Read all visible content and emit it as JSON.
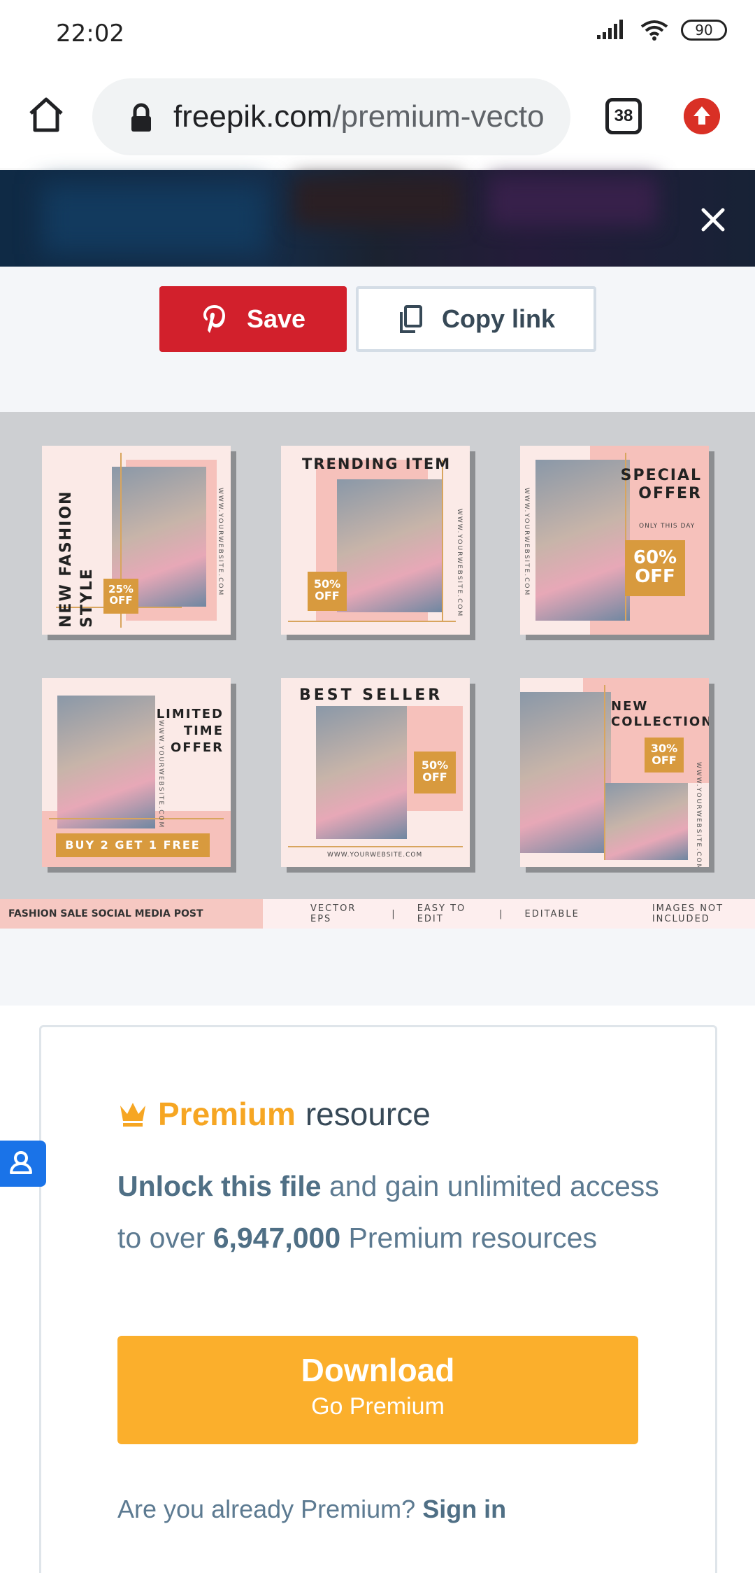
{
  "status_bar": {
    "time": "22:02",
    "battery": "90"
  },
  "browser": {
    "url_domain": "freepik.com",
    "url_path": "/premium-vecto",
    "tab_count": "38"
  },
  "share": {
    "save_label": "Save",
    "copy_label": "Copy link"
  },
  "preview": {
    "tiles": [
      {
        "title": "NEW FASHION STYLE",
        "badge": "25% OFF",
        "side": "WWW.YOURWEBSITE.COM"
      },
      {
        "title": "TRENDING ITEM",
        "badge": "50% OFF",
        "side": "WWW.YOURWEBSITE.COM"
      },
      {
        "title": "SPECIAL OFFER",
        "subtitle": "ONLY THIS DAY",
        "badge": "60% OFF",
        "side": "WWW.YOURWEBSITE.COM"
      },
      {
        "title": "LIMITED TIME OFFER",
        "badge": "BUY 2 GET 1 FREE",
        "side": "WWW.YOURWEBSITE.COM"
      },
      {
        "title": "BEST SELLER",
        "badge": "50% OFF",
        "side": "WWW.YOURWEBSITE.COM"
      },
      {
        "title": "NEW COLLECTION",
        "badge": "30% OFF",
        "side": "WWW.YOURWEBSITE.COM"
      }
    ],
    "footer_title": "FASHION SALE SOCIAL MEDIA POST TEMPLATE",
    "footer_items": [
      "VECTOR EPS",
      "|",
      "EASY TO EDIT",
      "|",
      "EDITABLE",
      "IMAGES NOT INCLUDED"
    ]
  },
  "premium": {
    "label_premium": "Premium",
    "label_resource": "resource",
    "unlock_bold": "Unlock this file",
    "unlock_text1": " and gain unlimited access to over ",
    "count": "6,947,000",
    "unlock_text2": " Premium resources",
    "download_label": "Download",
    "go_premium_label": "Go Premium",
    "already_text": "Are you already Premium? ",
    "sign_in_label": "Sign in"
  },
  "colors": {
    "accent": "#f6a623",
    "pinterest": "#d2202c",
    "text": "#5c7a91"
  }
}
